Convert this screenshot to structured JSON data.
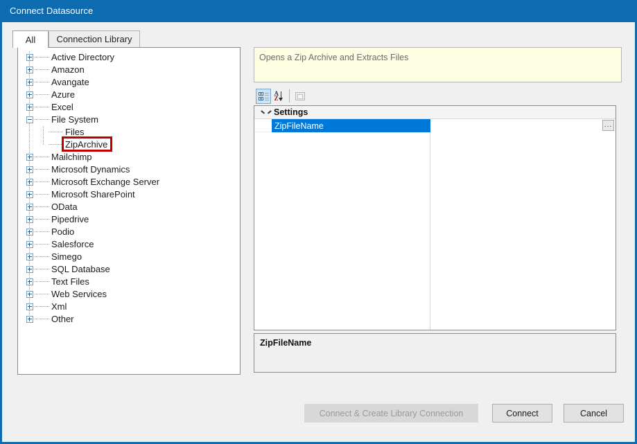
{
  "window": {
    "title": "Connect Datasource",
    "accent_color": "#0d6cb0"
  },
  "tabs": [
    {
      "label": "All",
      "active": true
    },
    {
      "label": "Connection Library",
      "active": false
    }
  ],
  "tree": {
    "nodes": [
      {
        "label": "Active Directory",
        "level": 0,
        "expander": "plus"
      },
      {
        "label": "Amazon",
        "level": 0,
        "expander": "plus"
      },
      {
        "label": "Avangate",
        "level": 0,
        "expander": "plus"
      },
      {
        "label": "Azure",
        "level": 0,
        "expander": "plus"
      },
      {
        "label": "Excel",
        "level": 0,
        "expander": "plus"
      },
      {
        "label": "File System",
        "level": 0,
        "expander": "minus"
      },
      {
        "label": "Files",
        "level": 1,
        "expander": "none"
      },
      {
        "label": "ZipArchive",
        "level": 1,
        "expander": "none",
        "annotated": true
      },
      {
        "label": "Mailchimp",
        "level": 0,
        "expander": "plus"
      },
      {
        "label": "Microsoft Dynamics",
        "level": 0,
        "expander": "plus"
      },
      {
        "label": "Microsoft Exchange Server",
        "level": 0,
        "expander": "plus"
      },
      {
        "label": "Microsoft SharePoint",
        "level": 0,
        "expander": "plus"
      },
      {
        "label": "OData",
        "level": 0,
        "expander": "plus"
      },
      {
        "label": "Pipedrive",
        "level": 0,
        "expander": "plus"
      },
      {
        "label": "Podio",
        "level": 0,
        "expander": "plus"
      },
      {
        "label": "Salesforce",
        "level": 0,
        "expander": "plus"
      },
      {
        "label": "Simego",
        "level": 0,
        "expander": "plus"
      },
      {
        "label": "SQL Database",
        "level": 0,
        "expander": "plus"
      },
      {
        "label": "Text Files",
        "level": 0,
        "expander": "plus"
      },
      {
        "label": "Web Services",
        "level": 0,
        "expander": "plus"
      },
      {
        "label": "Xml",
        "level": 0,
        "expander": "plus"
      },
      {
        "label": "Other",
        "level": 0,
        "expander": "plus"
      }
    ],
    "annotation_color": "#c00000"
  },
  "description": {
    "text": "Opens a Zip Archive and Extracts Files",
    "background_color": "#fdfde2"
  },
  "property_toolbar": {
    "buttons": [
      {
        "icon": "categorized-view-icon",
        "state": "pressed"
      },
      {
        "icon": "alphabetical-sort-icon",
        "state": "normal"
      },
      {
        "icon": "property-pages-icon",
        "state": "disabled"
      }
    ]
  },
  "property_grid": {
    "category": "Settings",
    "rows": [
      {
        "name": "ZipFileName",
        "value": "",
        "selected": true,
        "has_browse_button": true
      }
    ],
    "selection_color": "#0078d7",
    "browse_button_label": "..."
  },
  "help_panel": {
    "title": "ZipFileName",
    "body": ""
  },
  "buttons": {
    "create_library": {
      "label": "Connect & Create Library Connection",
      "enabled": false
    },
    "connect": {
      "label": "Connect",
      "enabled": true
    },
    "cancel": {
      "label": "Cancel",
      "enabled": true
    }
  }
}
